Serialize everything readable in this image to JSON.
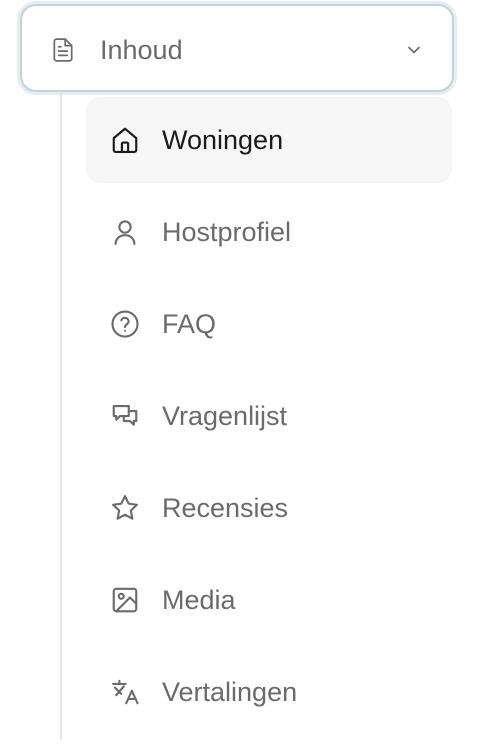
{
  "section": {
    "label": "Inhoud",
    "icon": "document-icon",
    "toggle_icon": "chevron-down-icon",
    "expanded": true
  },
  "submenu": {
    "items": [
      {
        "label": "Woningen",
        "icon": "home-icon",
        "active": true
      },
      {
        "label": "Hostprofiel",
        "icon": "user-icon",
        "active": false
      },
      {
        "label": "FAQ",
        "icon": "question-circle-icon",
        "active": false
      },
      {
        "label": "Vragenlijst",
        "icon": "chat-bubbles-icon",
        "active": false
      },
      {
        "label": "Recensies",
        "icon": "star-icon",
        "active": false
      },
      {
        "label": "Media",
        "icon": "image-icon",
        "active": false
      },
      {
        "label": "Vertalingen",
        "icon": "translate-icon",
        "active": false
      }
    ]
  },
  "colors": {
    "text_muted": "#6b6b6b",
    "text_active": "#1a1a1a",
    "active_bg": "#f6f6f6",
    "focus_ring": "#c3d3d9",
    "guide_line": "#e5e5e5"
  }
}
